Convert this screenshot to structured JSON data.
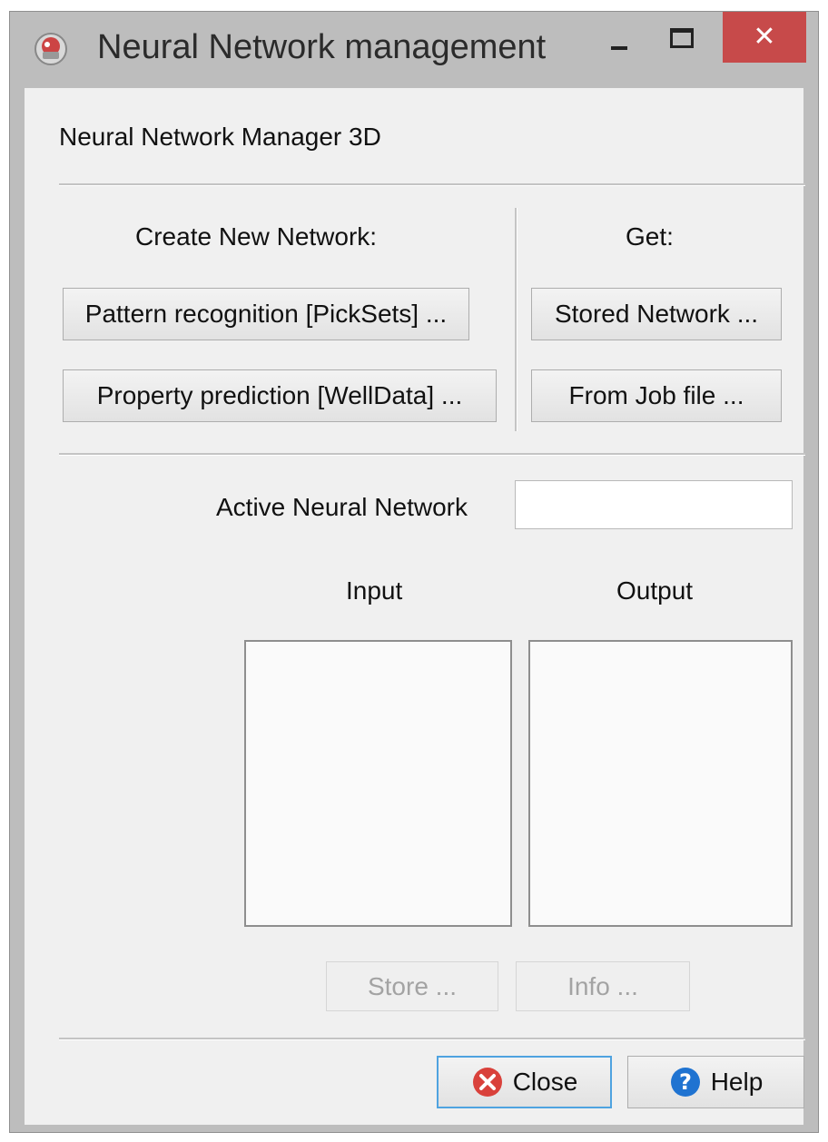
{
  "window": {
    "title": "Neural Network management",
    "close_glyph": "✕",
    "icons": {
      "app": "neural-network-app-icon",
      "minimize": "minimize-icon",
      "maximize": "maximize-icon",
      "close": "close-icon"
    }
  },
  "header": {
    "text": "Neural Network Manager 3D"
  },
  "create": {
    "label": "Create New Network:",
    "pattern_button": "Pattern recognition [PickSets] ...",
    "property_button": "Property prediction [WellData] ..."
  },
  "get": {
    "label": "Get:",
    "stored_button": "Stored Network ...",
    "jobfile_button": "From Job file ..."
  },
  "active": {
    "label": "Active Neural Network",
    "value": ""
  },
  "lists": {
    "input_label": "Input",
    "output_label": "Output"
  },
  "actions": {
    "store_button": "Store ...",
    "info_button": "Info ..."
  },
  "footer": {
    "close_button": "Close",
    "help_button": "Help",
    "icons": {
      "close": "close-circle-icon",
      "help": "help-icon"
    }
  },
  "colors": {
    "close_red": "#c74a4a",
    "help_blue": "#1f73d1",
    "focus_blue": "#4fa3e0"
  }
}
